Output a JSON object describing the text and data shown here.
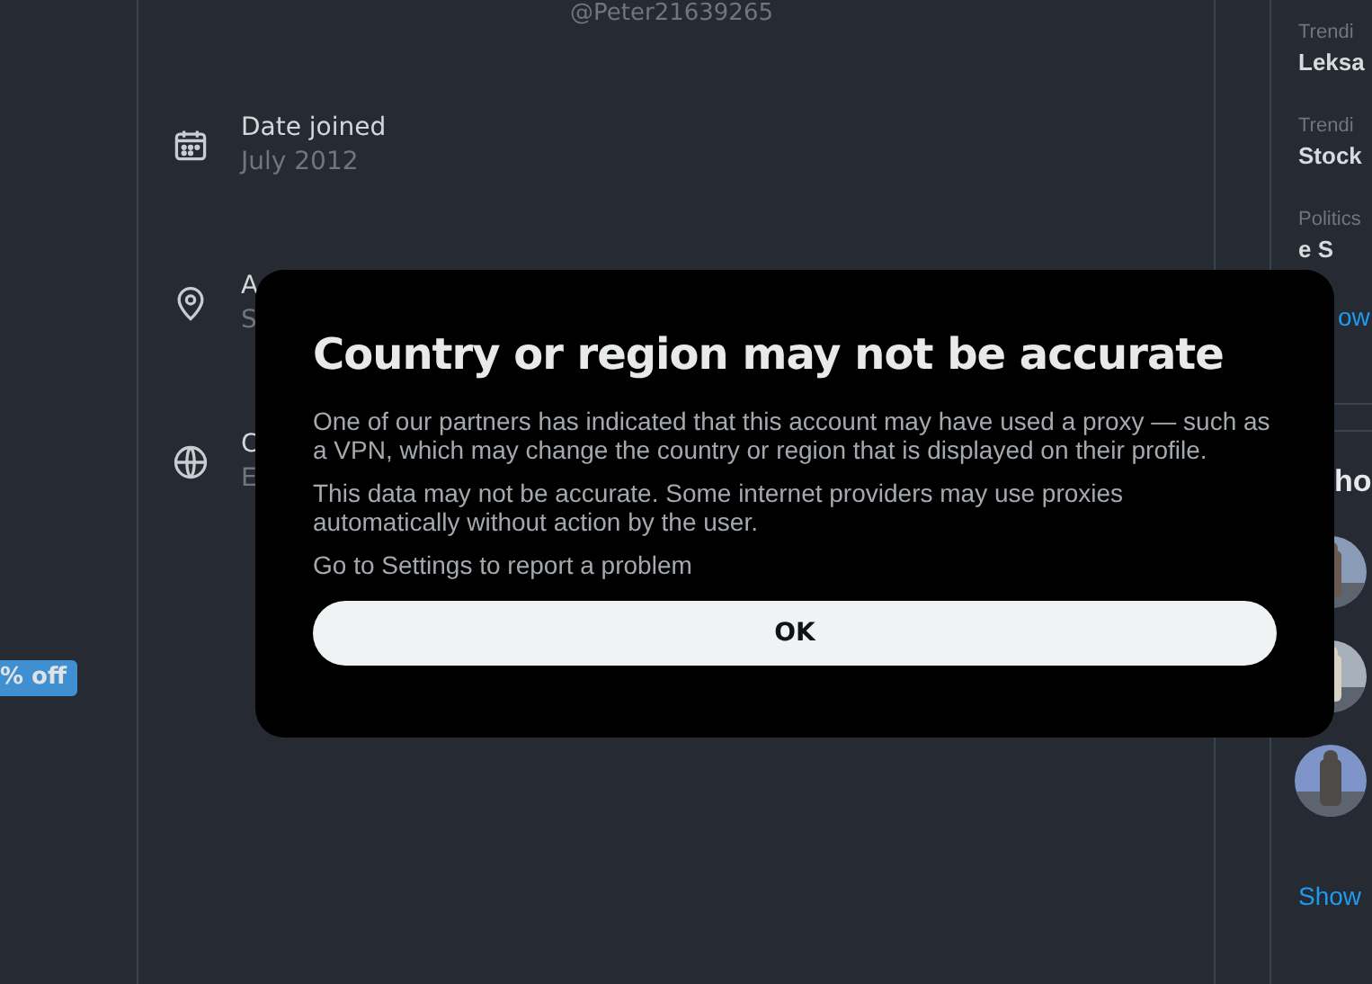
{
  "left_column": {
    "badge": "% off"
  },
  "profile": {
    "handle": "@Peter21639265",
    "details": [
      {
        "label": "Date joined",
        "value": "July 2012"
      },
      {
        "label": "A",
        "value": "S"
      },
      {
        "label": "C",
        "value": "E"
      }
    ]
  },
  "trends": [
    {
      "category": "Trendi",
      "title": "Leksa"
    },
    {
      "category": "Trendi",
      "title": "Stock"
    },
    {
      "category": "Politics",
      "title": "e S"
    }
  ],
  "trends_more": "ow",
  "who_to_follow": {
    "title": "ho",
    "show_more": "Show"
  },
  "dialog": {
    "title": "Country or region may not be accurate",
    "paragraphs": [
      "One of our partners has indicated that this account may have used a proxy — such as a VPN, which may change the country or region that is displayed on their profile.",
      "This data may not be accurate. Some internet providers may use proxies automatically without action by the user.",
      "Go to Settings to report a problem"
    ],
    "button": "OK"
  }
}
